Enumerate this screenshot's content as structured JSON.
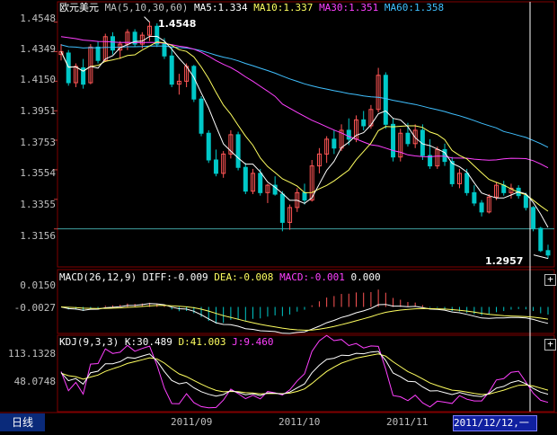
{
  "symbol": "欧元美元",
  "ma_header": {
    "indicator": "MA(5,10,30,60)",
    "ma5": "MA5:1.334",
    "ma10": "MA10:1.337",
    "ma30": "MA30:1.351",
    "ma60": "MA60:1.358"
  },
  "macd_header": {
    "indicator": "MACD(26,12,9)",
    "diff": "DIFF:-0.009",
    "dea": "DEA:-0.008",
    "macd": "MACD:-0.001",
    "zero": "0.000"
  },
  "kdj_header": {
    "indicator": "KDJ(9,3,3)",
    "k": "K:30.489",
    "d": "D:41.003",
    "j": "J:9.460"
  },
  "price_axis": [
    "1.4548",
    "1.4349",
    "1.4150",
    "1.3951",
    "1.3753",
    "1.3554",
    "1.3355",
    "1.3156"
  ],
  "macd_axis": [
    "0.0150",
    "-0.0027"
  ],
  "kdj_axis": [
    "113.1328",
    "48.0748"
  ],
  "date_labels": [
    "2011/09",
    "2011/10",
    "2011/11"
  ],
  "high_label": "1.4548",
  "low_label": "1.2957",
  "period_tab": "日线",
  "cursor_date": "2011/12/12,一",
  "colors": {
    "up": "#ff5555",
    "down": "#00c8c8",
    "ma5": "#ffffff",
    "ma10": "#ffff60",
    "ma30": "#ff40ff",
    "ma60": "#40c0ff",
    "grid": "#800000",
    "reference_line": "#40a0a0"
  },
  "chart_data": {
    "type": "candlestick",
    "price_range": [
      1.29,
      1.46
    ],
    "candles": [
      [
        1.433,
        1.44,
        1.429,
        1.435
      ],
      [
        1.434,
        1.436,
        1.412,
        1.414
      ],
      [
        1.414,
        1.427,
        1.411,
        1.425
      ],
      [
        1.424,
        1.43,
        1.41,
        1.413
      ],
      [
        1.414,
        1.44,
        1.413,
        1.438
      ],
      [
        1.438,
        1.442,
        1.427,
        1.429
      ],
      [
        1.429,
        1.447,
        1.428,
        1.445
      ],
      [
        1.445,
        1.448,
        1.433,
        1.436
      ],
      [
        1.436,
        1.442,
        1.43,
        1.44
      ],
      [
        1.44,
        1.45,
        1.436,
        1.448
      ],
      [
        1.448,
        1.45,
        1.438,
        1.44
      ],
      [
        1.44,
        1.448,
        1.437,
        1.446
      ],
      [
        1.446,
        1.4548,
        1.442,
        1.452
      ],
      [
        1.452,
        1.454,
        1.438,
        1.44
      ],
      [
        1.44,
        1.444,
        1.43,
        1.432
      ],
      [
        1.432,
        1.438,
        1.411,
        1.413
      ],
      [
        1.413,
        1.42,
        1.406,
        1.415
      ],
      [
        1.415,
        1.427,
        1.411,
        1.425
      ],
      [
        1.425,
        1.426,
        1.401,
        1.403
      ],
      [
        1.403,
        1.405,
        1.378,
        1.38
      ],
      [
        1.38,
        1.382,
        1.36,
        1.362
      ],
      [
        1.362,
        1.369,
        1.351,
        1.353
      ],
      [
        1.353,
        1.368,
        1.35,
        1.366
      ],
      [
        1.366,
        1.382,
        1.363,
        1.379
      ],
      [
        1.379,
        1.381,
        1.355,
        1.357
      ],
      [
        1.357,
        1.36,
        1.339,
        1.341
      ],
      [
        1.341,
        1.356,
        1.339,
        1.353
      ],
      [
        1.353,
        1.356,
        1.338,
        1.34
      ],
      [
        1.34,
        1.346,
        1.333,
        1.345
      ],
      [
        1.345,
        1.351,
        1.338,
        1.339
      ],
      [
        1.339,
        1.341,
        1.314,
        1.32
      ],
      [
        1.32,
        1.332,
        1.315,
        1.33
      ],
      [
        1.33,
        1.343,
        1.327,
        1.34
      ],
      [
        1.34,
        1.346,
        1.332,
        1.335
      ],
      [
        1.335,
        1.362,
        1.334,
        1.358
      ],
      [
        1.358,
        1.37,
        1.353,
        1.366
      ],
      [
        1.366,
        1.378,
        1.36,
        1.376
      ],
      [
        1.376,
        1.382,
        1.366,
        1.37
      ],
      [
        1.37,
        1.386,
        1.368,
        1.382
      ],
      [
        1.382,
        1.39,
        1.372,
        1.376
      ],
      [
        1.376,
        1.392,
        1.374,
        1.389
      ],
      [
        1.389,
        1.395,
        1.382,
        1.385
      ],
      [
        1.385,
        1.399,
        1.383,
        1.396
      ],
      [
        1.396,
        1.424,
        1.394,
        1.419
      ],
      [
        1.419,
        1.421,
        1.383,
        1.386
      ],
      [
        1.386,
        1.39,
        1.361,
        1.364
      ],
      [
        1.364,
        1.383,
        1.361,
        1.38
      ],
      [
        1.38,
        1.387,
        1.371,
        1.373
      ],
      [
        1.373,
        1.386,
        1.37,
        1.382
      ],
      [
        1.382,
        1.386,
        1.362,
        1.365
      ],
      [
        1.365,
        1.376,
        1.356,
        1.358
      ],
      [
        1.358,
        1.371,
        1.356,
        1.369
      ],
      [
        1.369,
        1.373,
        1.358,
        1.361
      ],
      [
        1.361,
        1.364,
        1.344,
        1.346
      ],
      [
        1.346,
        1.356,
        1.343,
        1.353
      ],
      [
        1.353,
        1.356,
        1.338,
        1.34
      ],
      [
        1.34,
        1.345,
        1.331,
        1.333
      ],
      [
        1.333,
        1.335,
        1.324,
        1.327
      ],
      [
        1.327,
        1.339,
        1.326,
        1.337
      ],
      [
        1.337,
        1.347,
        1.335,
        1.345
      ],
      [
        1.345,
        1.348,
        1.338,
        1.34
      ],
      [
        1.34,
        1.346,
        1.336,
        1.343
      ],
      [
        1.343,
        1.345,
        1.336,
        1.338
      ],
      [
        1.338,
        1.34,
        1.328,
        1.33
      ],
      [
        1.33,
        1.331,
        1.314,
        1.316
      ],
      [
        1.316,
        1.317,
        1.3,
        1.301
      ],
      [
        1.301,
        1.305,
        1.2957,
        1.298
      ]
    ],
    "highlight_high": 1.4548,
    "highlight_low": 1.2957,
    "reference_level": 1.3156
  }
}
